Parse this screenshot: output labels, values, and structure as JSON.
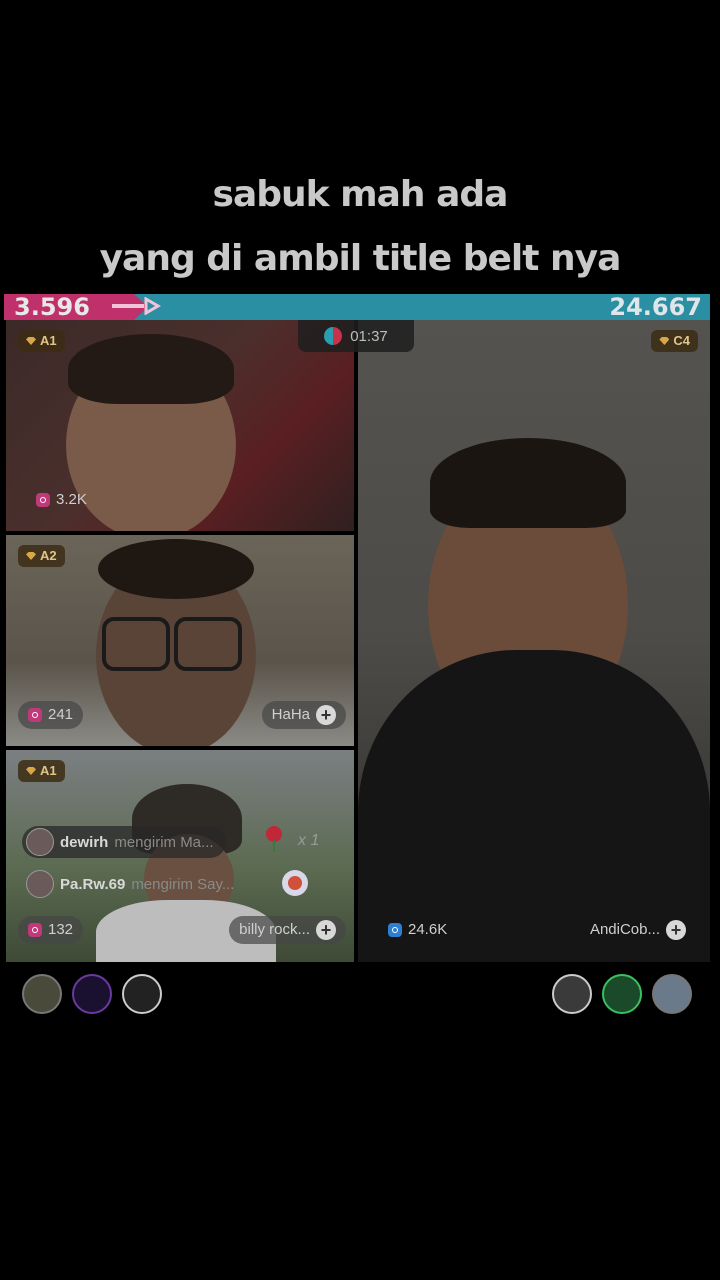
{
  "caption": {
    "line1": "sabuk mah ada",
    "line2": "yang di ambil title belt nya"
  },
  "scorebar": {
    "left_score": "3.596",
    "right_score": "24.667",
    "left_color": "#c0306a",
    "right_color": "#2b8fa3",
    "left_share": 0.127
  },
  "timer": "01:37",
  "tiles": [
    {
      "rank": "A1",
      "likes": "3.2K"
    },
    {
      "rank": "A2",
      "likes": "241",
      "guest_name": "HaHa"
    },
    {
      "rank": "A1",
      "likes": "132",
      "guest_name": "billy rock..."
    },
    {
      "rank": "C4",
      "likes": "24.6K",
      "guest_name": "AndiCob..."
    }
  ],
  "gifts": [
    {
      "user": "dewirh",
      "message": "mengirim Ma...",
      "count": "x 1"
    },
    {
      "user": "Pa.Rw.69",
      "message": "mengirim Say..."
    }
  ],
  "icons": {
    "rank": "diamond-icon",
    "likes": "camera-icon",
    "add": "plus-icon",
    "timer": "versus-icon",
    "gift_rose": "rose-icon",
    "gift_badge": "sticker-icon"
  }
}
